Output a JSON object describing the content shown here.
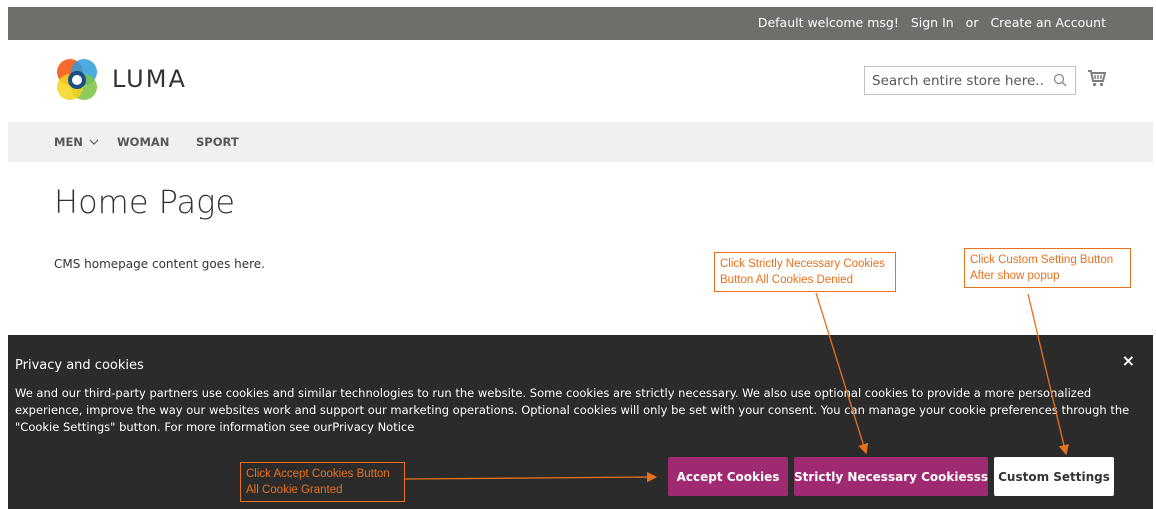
{
  "header": {
    "welcome": "Default welcome msg!",
    "sign_in": "Sign In",
    "or": "or",
    "create_account": "Create an Account"
  },
  "logo": {
    "text": "LUMA"
  },
  "search": {
    "placeholder": "Search entire store here..."
  },
  "nav": {
    "items": [
      {
        "label": "MEN",
        "icon": "chevron-down-icon"
      },
      {
        "label": "WOMAN"
      },
      {
        "label": "SPORT"
      }
    ]
  },
  "main": {
    "title": "Home Page",
    "content": "CMS homepage content goes here."
  },
  "cookie_banner": {
    "heading": "Privacy and cookies",
    "text": "We and our third-party partners use cookies and similar technologies to run the website. Some cookies are strictly necessary. We also use optional cookies to provide a more personalized experience, improve the way our websites work and support our marketing operations. Optional cookies will only be set with your consent. You can manage your cookie preferences through the \"Cookie Settings\" button. For more information see ourPrivacy Notice",
    "close": "×",
    "buttons": {
      "accept": "Accept Cookies",
      "strict": "Strictly Necessary Cookiesss",
      "custom": "Custom Settings"
    }
  },
  "annotations": {
    "strict": [
      "Click Strictly Necessary Cookies",
      "Button All Cookies Denied"
    ],
    "custom": [
      "Click Custom Setting  Button",
      "After show popup"
    ],
    "accept": [
      "Click Accept Cookies Button",
      "All  Cookie Granted"
    ]
  },
  "colors": {
    "topbar": "#6e6e6b",
    "accent": "#a02a72",
    "annotation": "#e8711d",
    "banner": "#2b2b2b"
  }
}
